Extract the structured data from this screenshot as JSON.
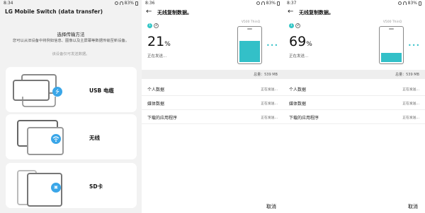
{
  "screens": [
    {
      "status": {
        "time": "8:34",
        "battery": "83%"
      },
      "title": "LG Mobile Switch (data transfer)",
      "heading": "选择传输方法",
      "description": "您可以从旧设备中将例如信息、图像以及主屏幕等数据传输至新设备。",
      "note": "该设备仅可发送数据。",
      "methods": [
        {
          "label": "USB 电缆",
          "icon": "usb-icon"
        },
        {
          "label": "无线",
          "icon": "wifi-icon"
        },
        {
          "label": "SD卡",
          "icon": "sd-card-icon"
        }
      ]
    },
    {
      "status": {
        "time": "8:36",
        "battery": "83%"
      },
      "title": "无线复制数据。",
      "steps": [
        "1",
        "2"
      ],
      "percent": "21",
      "percent_sign": "%",
      "progress": 0.65,
      "sending": "正在发送...",
      "device_model": "V500 ThinQ",
      "total": "总量：539 MB",
      "rows": [
        {
          "label": "个人数据",
          "status": "正在发送..."
        },
        {
          "label": "媒体数据",
          "status": "正在发送..."
        },
        {
          "label": "下载的应用程序",
          "status": "正在发送..."
        }
      ],
      "cancel": "取消"
    },
    {
      "status": {
        "time": "8:37",
        "battery": "83%"
      },
      "title": "无线复制数据。",
      "steps": [
        "1",
        "2"
      ],
      "percent": "69",
      "percent_sign": "%",
      "progress": 0.32,
      "sending": "正在发送...",
      "device_model": "V500 ThinQ",
      "total": "总量：539 MB",
      "rows": [
        {
          "label": "个人数据",
          "status": "正在发送..."
        },
        {
          "label": "媒体数据",
          "status": "正在发送..."
        },
        {
          "label": "下载的应用程序",
          "status": "正在发送..."
        }
      ],
      "cancel": "取消"
    }
  ],
  "colors": {
    "accent": "#33c0c8",
    "badge": "#3aa6e8",
    "background_gray": "#f2f2f2"
  }
}
